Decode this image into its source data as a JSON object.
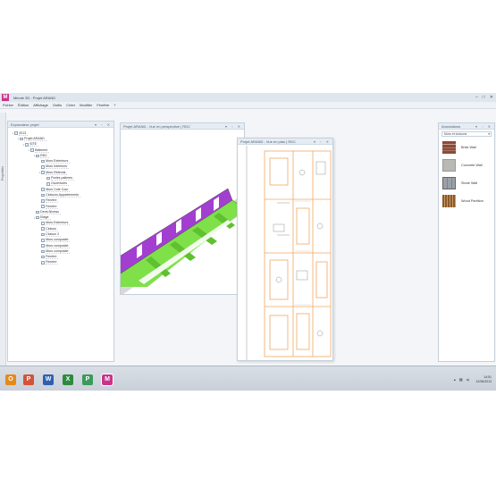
{
  "window": {
    "title": "Minute 3D - Projet ARAND",
    "logo": "M",
    "controls": [
      "–",
      "□",
      "✕"
    ]
  },
  "menu": [
    "Fichier",
    "Édition",
    "Affichage",
    "Outils",
    "Créer",
    "Modifier",
    "Fenêtre",
    "?"
  ],
  "side_tab": "Propriétés",
  "explorer": {
    "title": "Explorateur projet",
    "items": [
      {
        "label": "2013",
        "level": 0,
        "toggle": "▪"
      },
      {
        "label": "Projet ARAND",
        "level": 1,
        "toggle": "▪"
      },
      {
        "label": "SITE",
        "level": 2,
        "toggle": "▪"
      },
      {
        "label": "Batiment",
        "level": 3,
        "toggle": "▪"
      },
      {
        "label": "RDC",
        "level": 4,
        "toggle": "▪"
      },
      {
        "label": "Murs Exterieurs",
        "level": 5,
        "toggle": ""
      },
      {
        "label": "Murs Intérieurs",
        "level": 5,
        "toggle": ""
      },
      {
        "label": "Murs Refends",
        "level": 5,
        "toggle": "▪"
      },
      {
        "label": "Portes palieres",
        "level": 6,
        "toggle": ""
      },
      {
        "label": "Ouvertures",
        "level": 6,
        "toggle": ""
      },
      {
        "label": "Murs Coté Cour",
        "level": 5,
        "toggle": ""
      },
      {
        "label": "Cloisons Appartements",
        "level": 5,
        "toggle": ""
      },
      {
        "label": "Fenetre",
        "level": 5,
        "toggle": ""
      },
      {
        "label": "Fenetre",
        "level": 5,
        "toggle": ""
      },
      {
        "label": "Demi-Niveau",
        "level": 4,
        "toggle": ""
      },
      {
        "label": "Etage",
        "level": 4,
        "toggle": "▪"
      },
      {
        "label": "Murs Exterieurs",
        "level": 5,
        "toggle": ""
      },
      {
        "label": "Cloison",
        "level": 5,
        "toggle": ""
      },
      {
        "label": "Cloison 2",
        "level": 5,
        "toggle": ""
      },
      {
        "label": "Murs composite",
        "level": 5,
        "toggle": ""
      },
      {
        "label": "Murs composite",
        "level": 5,
        "toggle": ""
      },
      {
        "label": "Murs composite",
        "level": 5,
        "toggle": ""
      },
      {
        "label": "Fenetre",
        "level": 5,
        "toggle": ""
      },
      {
        "label": "Fenetre",
        "level": 5,
        "toggle": ""
      }
    ]
  },
  "perspective": {
    "title": "Projet ARAND - Vue en perspective | RDC",
    "buttons": "▾ ▫ ✕"
  },
  "plan": {
    "title": "Projet ARAND - Vue en plan | RDC",
    "buttons": "▾ ▫ ✕"
  },
  "annotations": {
    "title": "Annotations",
    "buttons": "▾ ▫ ✕",
    "category": "Murs et cloisons",
    "materials": [
      {
        "label": "Brick Wall",
        "color": "#8b4a3a"
      },
      {
        "label": "Concrete Wall",
        "color": "#b9b9b4"
      },
      {
        "label": "Stone Wall",
        "color": "#9aa0a8"
      },
      {
        "label": "Wood Partition",
        "color": "#8a5a2e"
      }
    ]
  },
  "taskbar": {
    "apps": [
      {
        "name": "outlook",
        "letter": "O",
        "color": "#e38a1a"
      },
      {
        "name": "powerpoint",
        "letter": "P",
        "color": "#d2533a"
      },
      {
        "name": "word",
        "letter": "W",
        "color": "#2f5fb3"
      },
      {
        "name": "excel",
        "letter": "X",
        "color": "#2e8b3e"
      },
      {
        "name": "publisher",
        "letter": "P",
        "color": "#3a9a5a"
      },
      {
        "name": "minute3d",
        "letter": "M",
        "color": "#c8348a"
      }
    ],
    "time": "14:51",
    "date": "12/06/2013"
  },
  "colors": {
    "wall_green": "#7fe04a",
    "wall_purple": "#a23fd0",
    "plan_orange": "#f0a860"
  }
}
